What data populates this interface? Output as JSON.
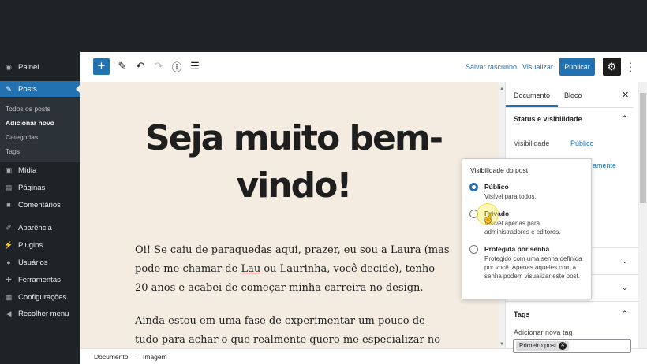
{
  "sidebar": {
    "items": [
      {
        "label": "Painel",
        "icon": "dashboard-icon"
      },
      {
        "label": "Posts",
        "icon": "pin-icon"
      },
      {
        "label": "Mídia",
        "icon": "media-icon"
      },
      {
        "label": "Páginas",
        "icon": "pages-icon"
      },
      {
        "label": "Comentários",
        "icon": "comment-icon"
      },
      {
        "label": "Aparência",
        "icon": "brush-icon"
      },
      {
        "label": "Plugins",
        "icon": "plugin-icon"
      },
      {
        "label": "Usuários",
        "icon": "users-icon"
      },
      {
        "label": "Ferramentas",
        "icon": "wrench-icon"
      },
      {
        "label": "Configurações",
        "icon": "settings-icon"
      },
      {
        "label": "Recolher menu",
        "icon": "collapse-icon"
      }
    ],
    "posts_sub": [
      "Todos os posts",
      "Adicionar novo",
      "Categorias",
      "Tags"
    ]
  },
  "toolbar": {
    "save_draft": "Salvar rascunho",
    "preview": "Visualizar",
    "publish": "Publicar"
  },
  "post": {
    "title_line1": "Seja muito bem-",
    "title_line2": "vindo!",
    "para1_a": "Oi! Se caiu de paraquedas aqui, prazer, eu sou a Laura (mas pode me chamar de ",
    "para1_link": "Lau",
    "para1_b": " ou Laurinha, você decide), tenho 20 anos e acabei de começar minha carreira no design.",
    "para2": "Ainda estou em uma fase de experimentar um pouco de tudo para achar o que realmente quero me especializar no futuro, mas já deixo o spoiler"
  },
  "panel": {
    "tab_document": "Documento",
    "tab_block": "Bloco",
    "status_title": "Status e visibilidade",
    "visibility_label": "Visibilidade",
    "visibility_value": "Público",
    "hidden_link_tail": "amente",
    "tags_title": "Tags",
    "add_tag_label": "Adicionar nova tag",
    "tag_chip": "Primeiro post"
  },
  "popover": {
    "title": "Visibilidade do post",
    "options": [
      {
        "label": "Público",
        "desc": "Visível para todos.",
        "checked": true
      },
      {
        "label": "Privado",
        "desc": "Visível apenas para administradores e editores.",
        "checked": false
      },
      {
        "label": "Protegida por senha",
        "desc": "Protegido com uma senha definida por você. Apenas aqueles com a senha podem visualizar este post.",
        "checked": false
      }
    ]
  },
  "footer": {
    "crumb1": "Documento",
    "arrow": "→",
    "crumb2": "Imagem"
  },
  "colors": {
    "accent": "#2271b1",
    "admin_bg": "#1d2327",
    "canvas_bg": "#f4ece1"
  }
}
